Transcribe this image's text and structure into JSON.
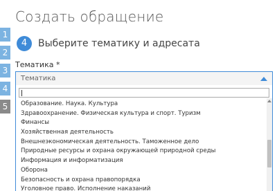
{
  "page": {
    "title": "Создать обращение"
  },
  "steps": [
    "1",
    "2",
    "3",
    "4",
    "5"
  ],
  "current_step": {
    "number": "4",
    "heading": "Выберите тематику и адресата"
  },
  "form": {
    "topic_label": "Тематика *",
    "select": {
      "value": "Тематика",
      "search_value": "",
      "options": [
        "Образование. Наука. Культура",
        "Здравоохранение. Физическая культура и спорт. Туризм",
        "Финансы",
        "Хозяйственная деятельность",
        "Внешнеэкономическая деятельность. Таможенное дело",
        "Природные ресурсы и охрана окружающей природной среды",
        "Информация и информатизация",
        "Оборона",
        "Безопасность и охрана правопорядка",
        "Уголовное право. Исполнение наказаний"
      ]
    }
  },
  "colors": {
    "accent": "#3f8bd8",
    "step_inactive": "#7cb3e1",
    "step_active": "#8a8a8a"
  }
}
